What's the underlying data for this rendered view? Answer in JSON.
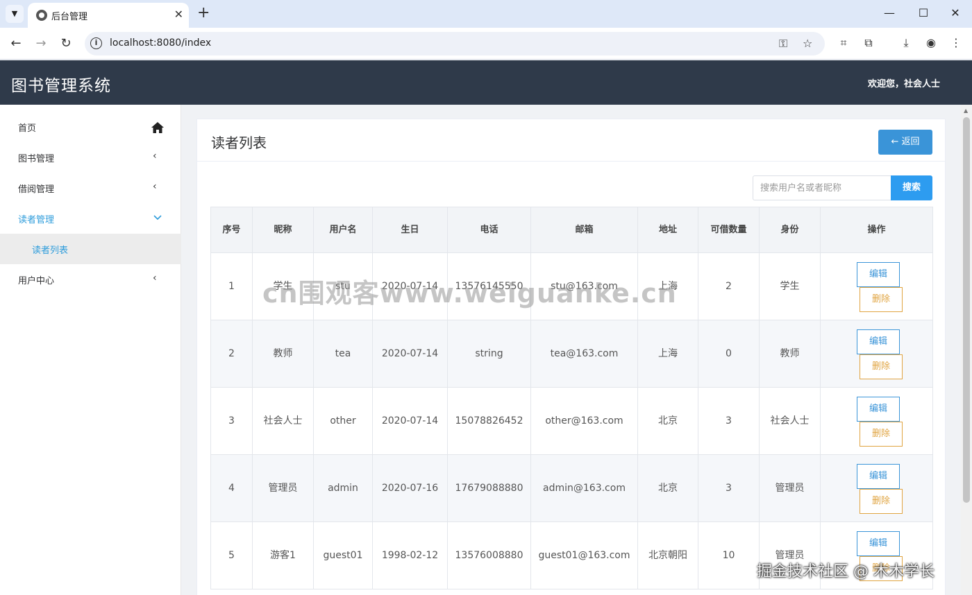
{
  "browser": {
    "tab_title": "后台管理",
    "tab_close": "✕",
    "new_tab": "+",
    "url": "localhost:8080/index"
  },
  "header": {
    "title": "图书管理系统",
    "welcome": "欢迎您，社会人士"
  },
  "sidebar": {
    "items": [
      {
        "label": "首页"
      },
      {
        "label": "图书管理"
      },
      {
        "label": "借阅管理"
      },
      {
        "label": "读者管理"
      },
      {
        "label": "用户中心"
      }
    ],
    "sub_item": "读者列表"
  },
  "main": {
    "title": "读者列表",
    "back_label": "返回",
    "search_placeholder": "搜索用户名或者昵称",
    "search_label": "搜索",
    "columns": [
      "序号",
      "昵称",
      "用户名",
      "生日",
      "电话",
      "邮箱",
      "地址",
      "可借数量",
      "身份",
      "操作"
    ],
    "rows": [
      {
        "no": "1",
        "nickname": "学生",
        "username": "stu",
        "birthday": "2020-07-14",
        "phone": "13576145550",
        "email": "stu@163.com",
        "address": "上海",
        "quota": "2",
        "role": "学生"
      },
      {
        "no": "2",
        "nickname": "教师",
        "username": "tea",
        "birthday": "2020-07-14",
        "phone": "string",
        "email": "tea@163.com",
        "address": "上海",
        "quota": "0",
        "role": "教师"
      },
      {
        "no": "3",
        "nickname": "社会人士",
        "username": "other",
        "birthday": "2020-07-14",
        "phone": "15078826452",
        "email": "other@163.com",
        "address": "北京",
        "quota": "3",
        "role": "社会人士"
      },
      {
        "no": "4",
        "nickname": "管理员",
        "username": "admin",
        "birthday": "2020-07-16",
        "phone": "17679088880",
        "email": "admin@163.com",
        "address": "北京",
        "quota": "3",
        "role": "管理员"
      },
      {
        "no": "5",
        "nickname": "游客1",
        "username": "guest01",
        "birthday": "1998-02-12",
        "phone": "13576008880",
        "email": "guest01@163.com",
        "address": "北京朝阳",
        "quota": "10",
        "role": "管理员"
      }
    ],
    "edit_label": "编辑",
    "delete_label": "删除"
  },
  "watermarks": {
    "center": "cn围观客www.weiguanke.cn",
    "corner": "掘金技术社区 @ 木木学长"
  }
}
